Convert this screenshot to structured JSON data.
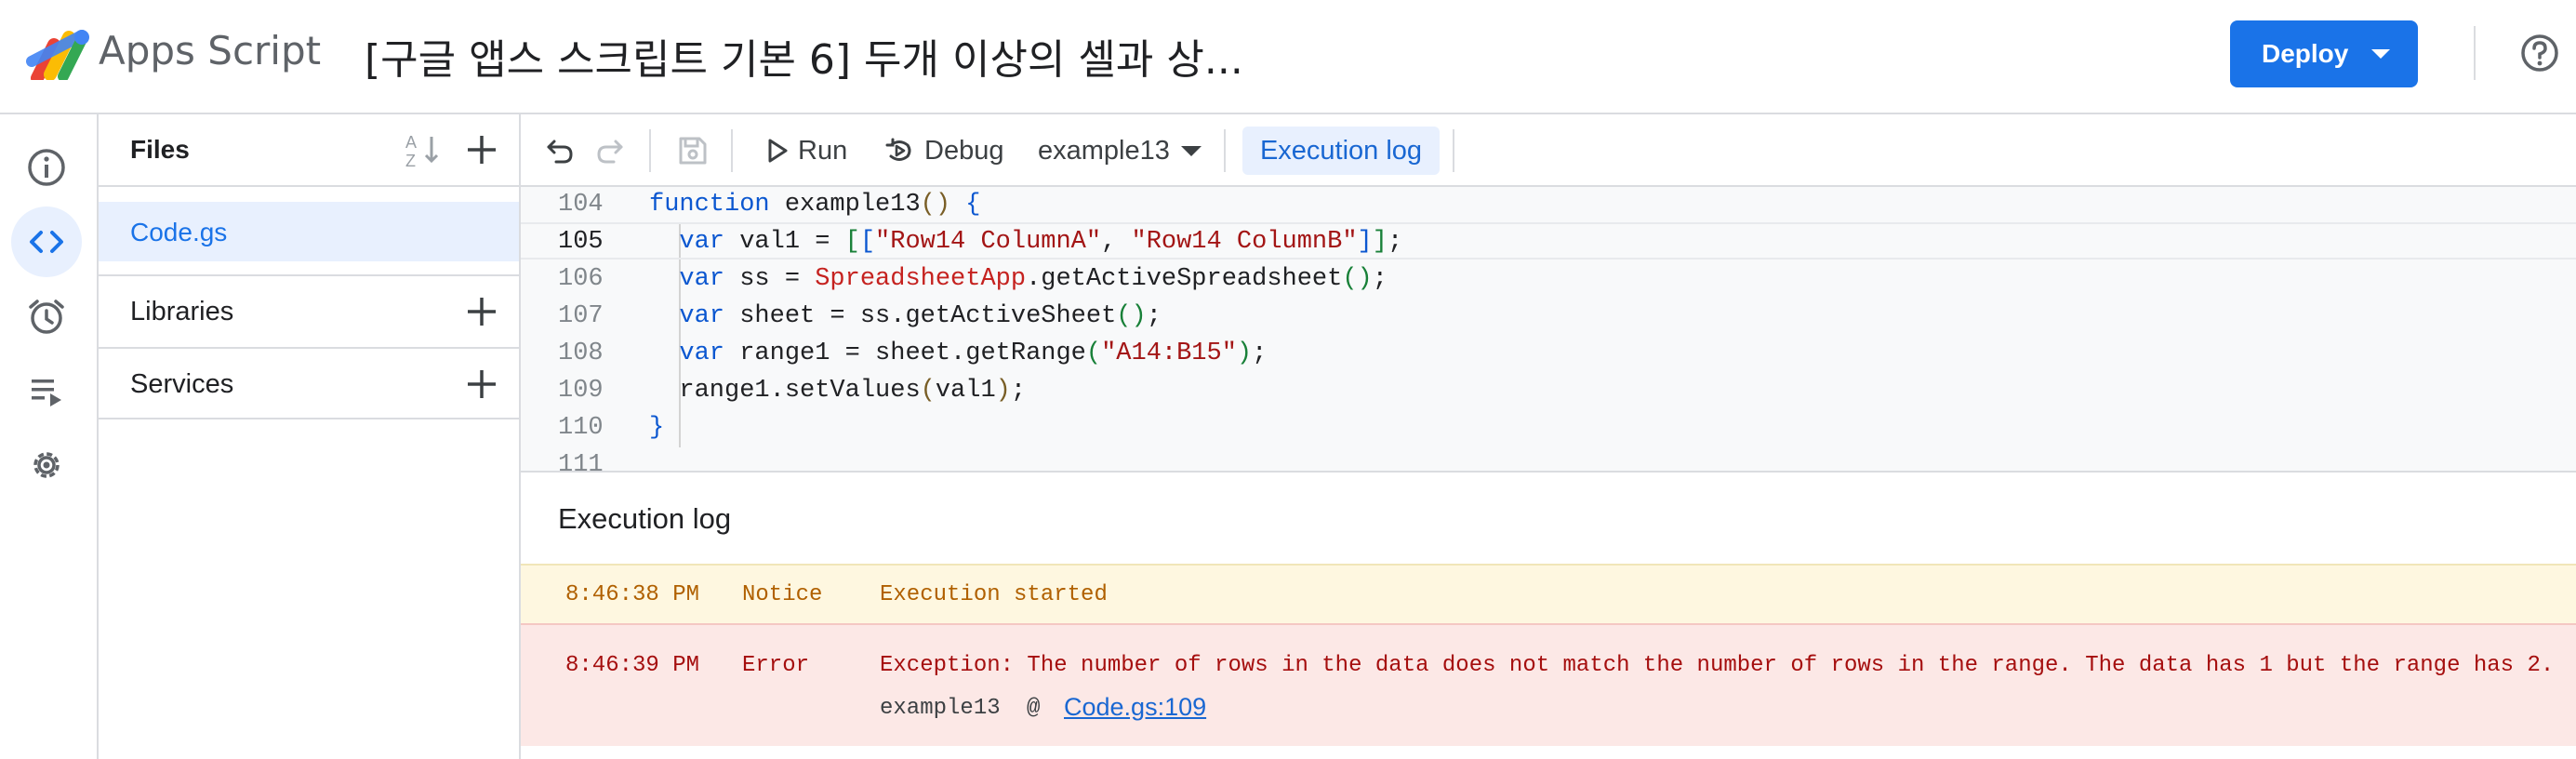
{
  "app": {
    "name": "Apps Script",
    "project_title": "[구글 앱스 스크립트 기본 6] 두개 이상의 셀과 상...",
    "deploy_label": "Deploy"
  },
  "rail": {
    "items": [
      {
        "icon": "info-icon"
      },
      {
        "icon": "code-icon",
        "active": true
      },
      {
        "icon": "alarm-icon"
      },
      {
        "icon": "executions-icon"
      },
      {
        "icon": "settings-icon"
      }
    ]
  },
  "files": {
    "title": "Files",
    "items": [
      {
        "name": "Code.gs"
      }
    ],
    "libraries_label": "Libraries",
    "services_label": "Services"
  },
  "toolbar": {
    "run_label": "Run",
    "debug_label": "Debug",
    "function_select": "example13",
    "execution_log_label": "Execution log"
  },
  "editor": {
    "lines": [
      {
        "num": "104",
        "text": "function example13() {"
      },
      {
        "num": "105",
        "text": "  var val1 = [[\"Row14 ColumnA\", \"Row14 ColumnB\"]];"
      },
      {
        "num": "106",
        "text": "  var ss = SpreadsheetApp.getActiveSpreadsheet();"
      },
      {
        "num": "107",
        "text": "  var sheet = ss.getActiveSheet();"
      },
      {
        "num": "108",
        "text": "  var range1 = sheet.getRange(\"A14:B15\");"
      },
      {
        "num": "109",
        "text": "  range1.setValues(val1);"
      },
      {
        "num": "110",
        "text": "}"
      },
      {
        "num": "111",
        "text": ""
      }
    ]
  },
  "execution_log": {
    "title": "Execution log",
    "entries": [
      {
        "time": "8:46:38 PM",
        "level": "Notice",
        "message": "Execution started"
      },
      {
        "time": "8:46:39 PM",
        "level": "Error",
        "message": "Exception: The number of rows in the data does not match the number of rows in the range. The data has 1 but the range has 2.",
        "stack_function": "example13",
        "stack_at": "@",
        "stack_link": "Code.gs:109"
      }
    ]
  },
  "colors": {
    "accent": "#1a73e8",
    "notice_bg": "#fef7e0",
    "error_bg": "#fce8e6"
  }
}
